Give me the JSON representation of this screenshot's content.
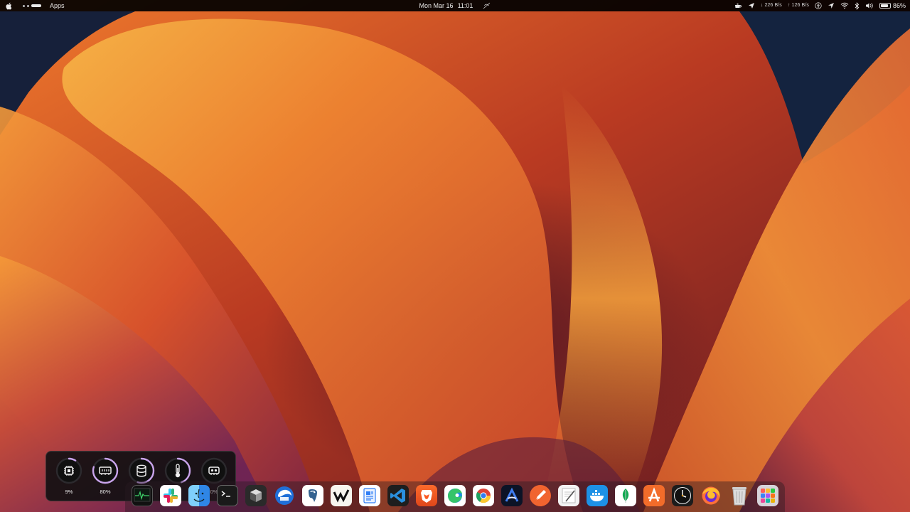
{
  "menubar": {
    "apple_icon": "apple-logo",
    "app_label": "Apps",
    "date": "Mon Mar 16",
    "time": "11:01",
    "net_down": "↓ 226 B/s",
    "net_up": "↑ 126 B/s",
    "battery_percent": "86%",
    "battery_level": 0.86
  },
  "widget": {
    "gauges": [
      {
        "icon": "cpu-chip-icon",
        "value": "9%",
        "fraction": 0.09
      },
      {
        "icon": "memory-icon",
        "value": "80%",
        "fraction": 0.8
      },
      {
        "icon": "disk-icon",
        "value": "",
        "fraction": 0.55
      },
      {
        "icon": "thermometer-icon",
        "value": "",
        "fraction": 0.45
      },
      {
        "icon": "gpu-icon",
        "value": "0%",
        "fraction": 0.0
      }
    ],
    "accent": "#c9a4ec"
  },
  "dock": {
    "apps": [
      "Activity Monitor",
      "Slack",
      "Finder",
      "Terminal",
      "Cube",
      "Thunderbird",
      "Postgres",
      "Warp",
      "Pages",
      "Visual Studio Code",
      "Brave",
      "Edge",
      "Chrome",
      "Arc",
      "Quill",
      "TextEdit",
      "Docker",
      "MongoDB",
      "App Store",
      "Clock",
      "Firefox",
      "Trash",
      "Launchpad"
    ]
  }
}
